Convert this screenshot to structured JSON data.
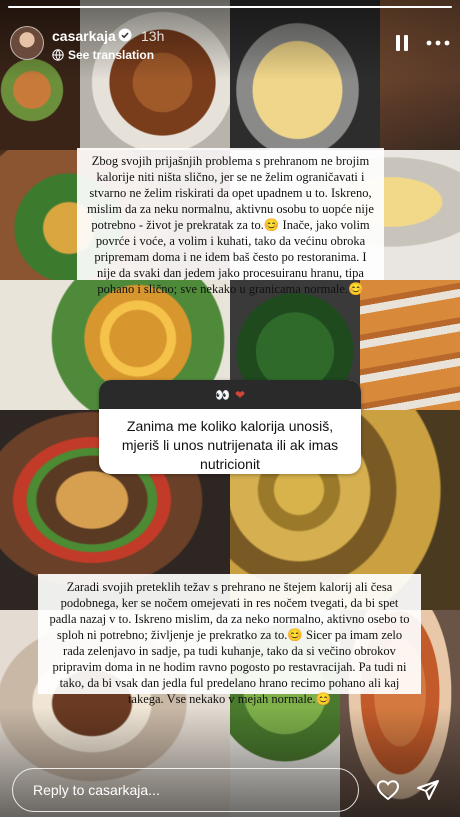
{
  "story": {
    "progress_fraction": 1.0
  },
  "header": {
    "username": "casarkaja",
    "time": "13h",
    "translate_label": "See translation"
  },
  "caption_hr": "Zbog svojih prijašnjih problema s prehranom ne brojim kalorije niti ništa slično, jer se ne želim ograničavati i stvarno ne želim riskirati da opet upadnem u to. Iskreno, mislim da za neku normalnu, aktivnu osobu to uopće nije potrebno - život je prekratak za to.😊 Inače, jako volim povrće i voće, a volim i kuhati, tako da većinu obroka pripremam doma i ne idem baš često po restoranima. I nije da svaki dan jedem jako procesuiranu hranu, tipa pohano i slično; sve nekako u granicama normale.😊",
  "question": {
    "emoji": "👀",
    "emoji_heart": "❤",
    "text": "Zanima me koliko kalorija unosiš, mjeriš li unos nutrijenata ili ak imas nutricionit"
  },
  "caption_sl": "Zaradi svojih preteklih težav s prehrano ne štejem kalorij ali česa podobnega, ker se nočem omejevati in res nočem tvegati, da bi spet padla nazaj v to. Iskreno mislim, da za neko normalno, aktivno osebo to sploh ni potrebno; življenje je prekratko za to.😊 Sicer pa imam zelo rada zelenjavo in sadje, pa tudi kuhanje, tako da si večino obrokov pripravim doma in ne hodim ravno pogosto po restavracijah. Pa tudi ni tako, da bi vsak dan jedla ful predelano hrano recimo pohano ali kaj takega. Vse nekako v mejah normale.😊",
  "footer": {
    "reply_placeholder": "Reply to casarkaja..."
  },
  "icons": {
    "verified": "verified-badge-icon",
    "translate": "translate-icon",
    "pause": "pause-icon",
    "more": "more-horizontal-icon",
    "heart": "heart-icon",
    "share": "paper-plane-icon"
  }
}
